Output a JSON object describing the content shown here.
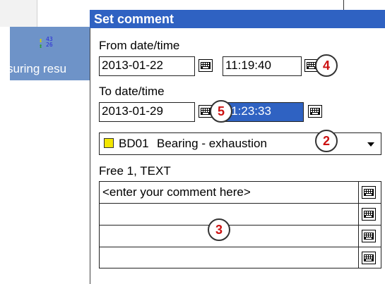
{
  "background": {
    "tab_label": "suring resu",
    "tab_icon": {
      "top_value": "43",
      "bottom_value": "26"
    }
  },
  "dialog": {
    "title": "Set comment",
    "from_label": "From date/time",
    "from_date": "2013-01-22",
    "from_time": "11:19:40",
    "to_label": "To date/time",
    "to_date": "2013-01-29",
    "to_time": "11:23:33",
    "combo": {
      "code": "BD01",
      "text": "Bearing - exhaustion",
      "swatch_color": "#f2e600"
    },
    "free_label": "Free 1, TEXT",
    "comment_rows": [
      "<enter your comment here>",
      "",
      "",
      ""
    ]
  },
  "badges": {
    "b4": "4",
    "b5": "5",
    "b2": "2",
    "b3": "3"
  },
  "colors": {
    "title_bar": "#2f62c2",
    "tab": "#6e93c8",
    "badge_text": "#cc1111"
  }
}
